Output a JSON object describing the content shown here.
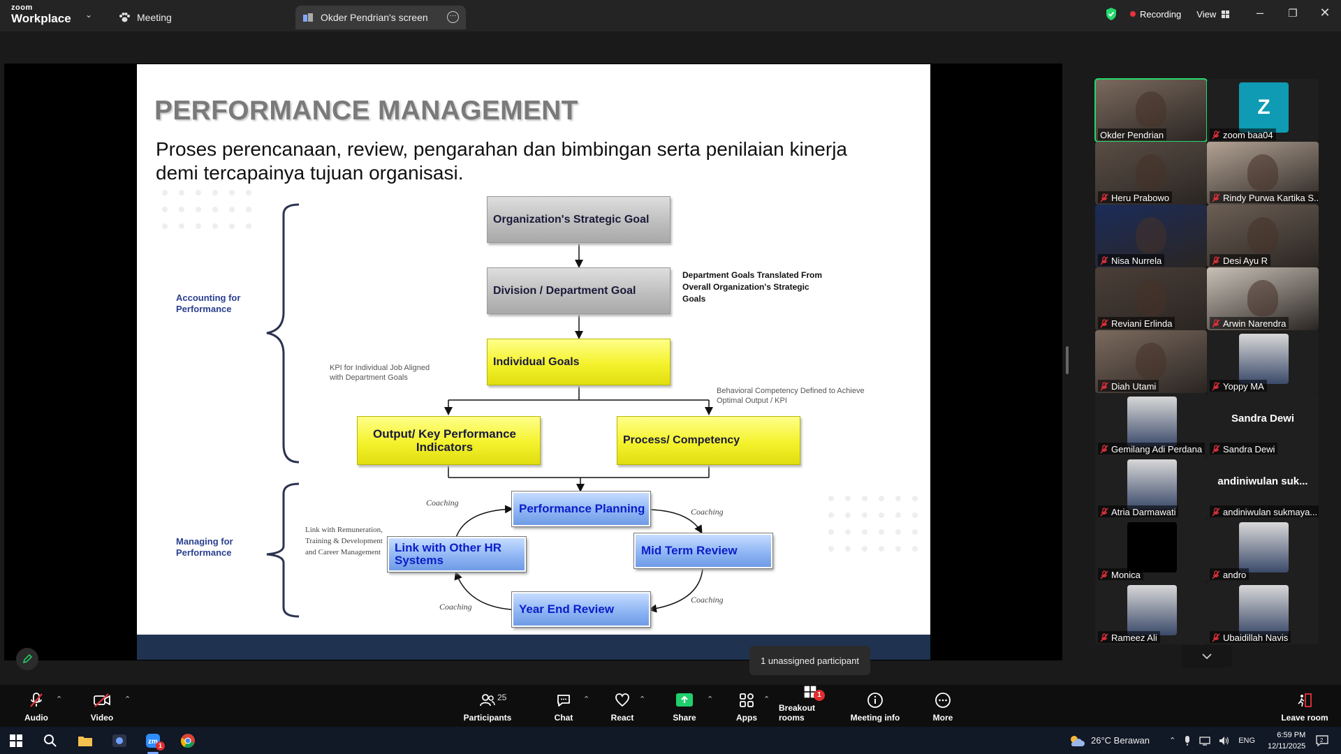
{
  "app": {
    "brand_top": "zoom",
    "brand_bottom": "Workplace"
  },
  "titlebar": {
    "meeting_tab": "Meeting",
    "screen_tab": "Okder Pendrian's screen",
    "recording": "Recording",
    "view": "View"
  },
  "slide": {
    "title": "PERFORMANCE MANAGEMENT",
    "subtitle": "Proses perencanaan, review, pengarahan dan bimbingan serta penilaian kinerja demi tercapainya tujuan organisasi.",
    "label_accounting": "Accounting for Performance",
    "label_managing": "Managing for Performance",
    "box_org_goal": "Organization's Strategic  Goal",
    "box_div_goal": "Division / Department Goal",
    "box_indiv_goal": "Individual Goals",
    "box_output_kpi": "Output/ Key Performance Indicators",
    "box_process": "Process/ Competency",
    "box_perf_planning": "Performance Planning",
    "box_link_hr": "Link with Other HR Systems",
    "box_mid_term": "Mid Term Review",
    "box_year_end": "Year End Review",
    "note_dept": "Department  Goals Translated From Overall Organization's Strategic Goals",
    "note_kpi": "KPI for Individual Job Aligned with Department Goals",
    "note_behavioral": "Behavioral Competency Defined to Achieve Optimal Output / KPI",
    "note_link": "Link with Remuneration, Training & Development and Career Management",
    "coaching": "Coaching"
  },
  "participants": [
    {
      "name": "Okder Pendrian",
      "type": "video",
      "active": true
    },
    {
      "name": "zoom baa04",
      "type": "letter",
      "letter": "Z"
    },
    {
      "name": "Heru Prabowo",
      "type": "video"
    },
    {
      "name": "Rindy Purwa Kartika S...",
      "type": "video"
    },
    {
      "name": "Nisa Nurrela",
      "type": "video"
    },
    {
      "name": "Desi Ayu R",
      "type": "video"
    },
    {
      "name": "Reviani Erlinda",
      "type": "video"
    },
    {
      "name": "Arwin Narendra",
      "type": "video"
    },
    {
      "name": "Diah Utami",
      "type": "video"
    },
    {
      "name": "Yoppy MA",
      "type": "photo"
    },
    {
      "name": "Gemilang Adi Perdana",
      "type": "photo"
    },
    {
      "name": "Sandra Dewi",
      "type": "name",
      "display": "Sandra Dewi"
    },
    {
      "name": "Atria Darmawati",
      "type": "photo"
    },
    {
      "name": "andiniwulan sukmaya...",
      "type": "name",
      "display": "andiniwulan  suk..."
    },
    {
      "name": "Monica",
      "type": "black"
    },
    {
      "name": "andro",
      "type": "photo"
    },
    {
      "name": "Rameez Ali",
      "type": "photo"
    },
    {
      "name": "Ubaidillah Navis",
      "type": "photo"
    }
  ],
  "tooltip": "1 unassigned participant",
  "toolbar": {
    "audio": "Audio",
    "video": "Video",
    "participants": "Participants",
    "participants_count": "25",
    "chat": "Chat",
    "react": "React",
    "share": "Share",
    "apps": "Apps",
    "breakout": "Breakout rooms",
    "breakout_badge": "1",
    "meeting_info": "Meeting info",
    "more": "More",
    "leave": "Leave room"
  },
  "taskbar": {
    "weather": "26°C  Berawan",
    "lang": "ENG",
    "time": "6:59 PM",
    "date": "12/11/2025",
    "notif": "2",
    "zoom_badge": "1"
  },
  "colors": {
    "accent_green": "#23d96b",
    "rec_red": "#e8323c",
    "share_green": "#1fd16c",
    "slide_label_blue": "#2a3f8f"
  }
}
